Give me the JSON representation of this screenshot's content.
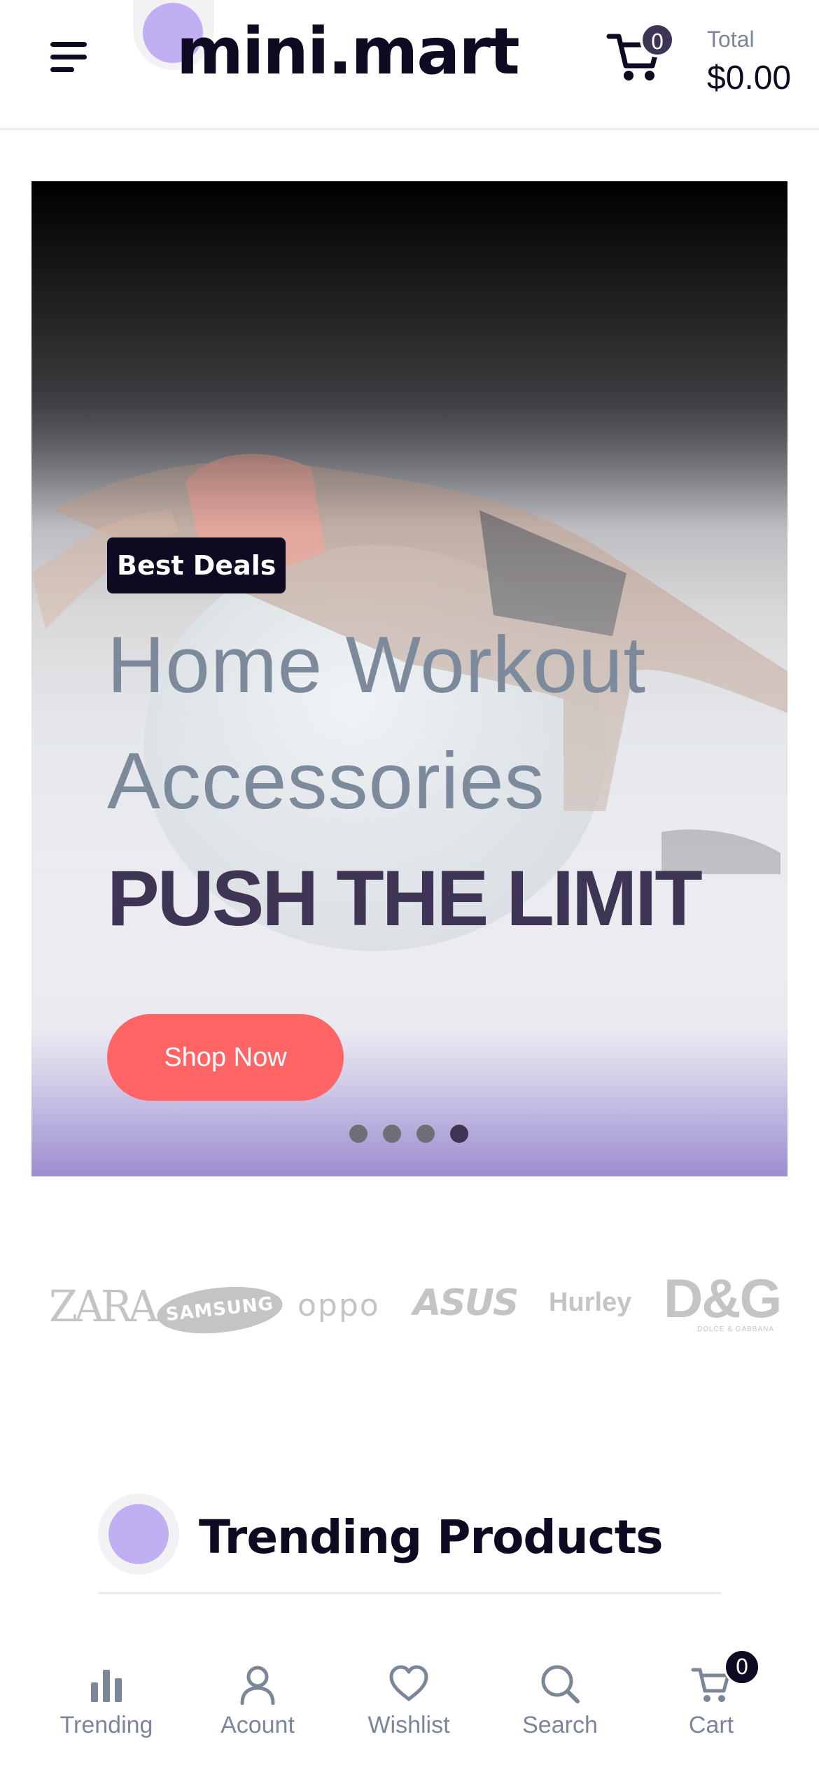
{
  "header": {
    "brand_name": "mini.mart",
    "cart_count": "0",
    "total_label": "Total",
    "total_value": "$0.00"
  },
  "hero": {
    "badge": "Best Deals",
    "line1": "Home Workout",
    "line2": "Accessories",
    "line3": "PUSH THE LIMIT",
    "cta_label": "Shop Now",
    "slide_count": 4,
    "active_slide": 4
  },
  "brands": {
    "zara": "ZARA",
    "samsung": "SAMSUNG",
    "oppo": "oppo",
    "asus": "ASUS",
    "hurley": "Hurley",
    "dg": "D&G",
    "dg_sub": "DOLCE & GABBANA"
  },
  "section": {
    "title": "Trending Products"
  },
  "bottom_nav": {
    "items": [
      {
        "label": "Trending",
        "icon": "bar-chart-icon"
      },
      {
        "label": "Acount",
        "icon": "user-icon"
      },
      {
        "label": "Wishlist",
        "icon": "heart-icon"
      },
      {
        "label": "Search",
        "icon": "search-icon"
      },
      {
        "label": "Cart",
        "icon": "cart-icon"
      }
    ],
    "cart_count": "0"
  },
  "colors": {
    "primary_dark": "#0e0a21",
    "accent_purple": "#c0aff3",
    "cta_red": "#fe6564",
    "muted_text": "#7b8698",
    "heading_purple": "#3d3553"
  }
}
